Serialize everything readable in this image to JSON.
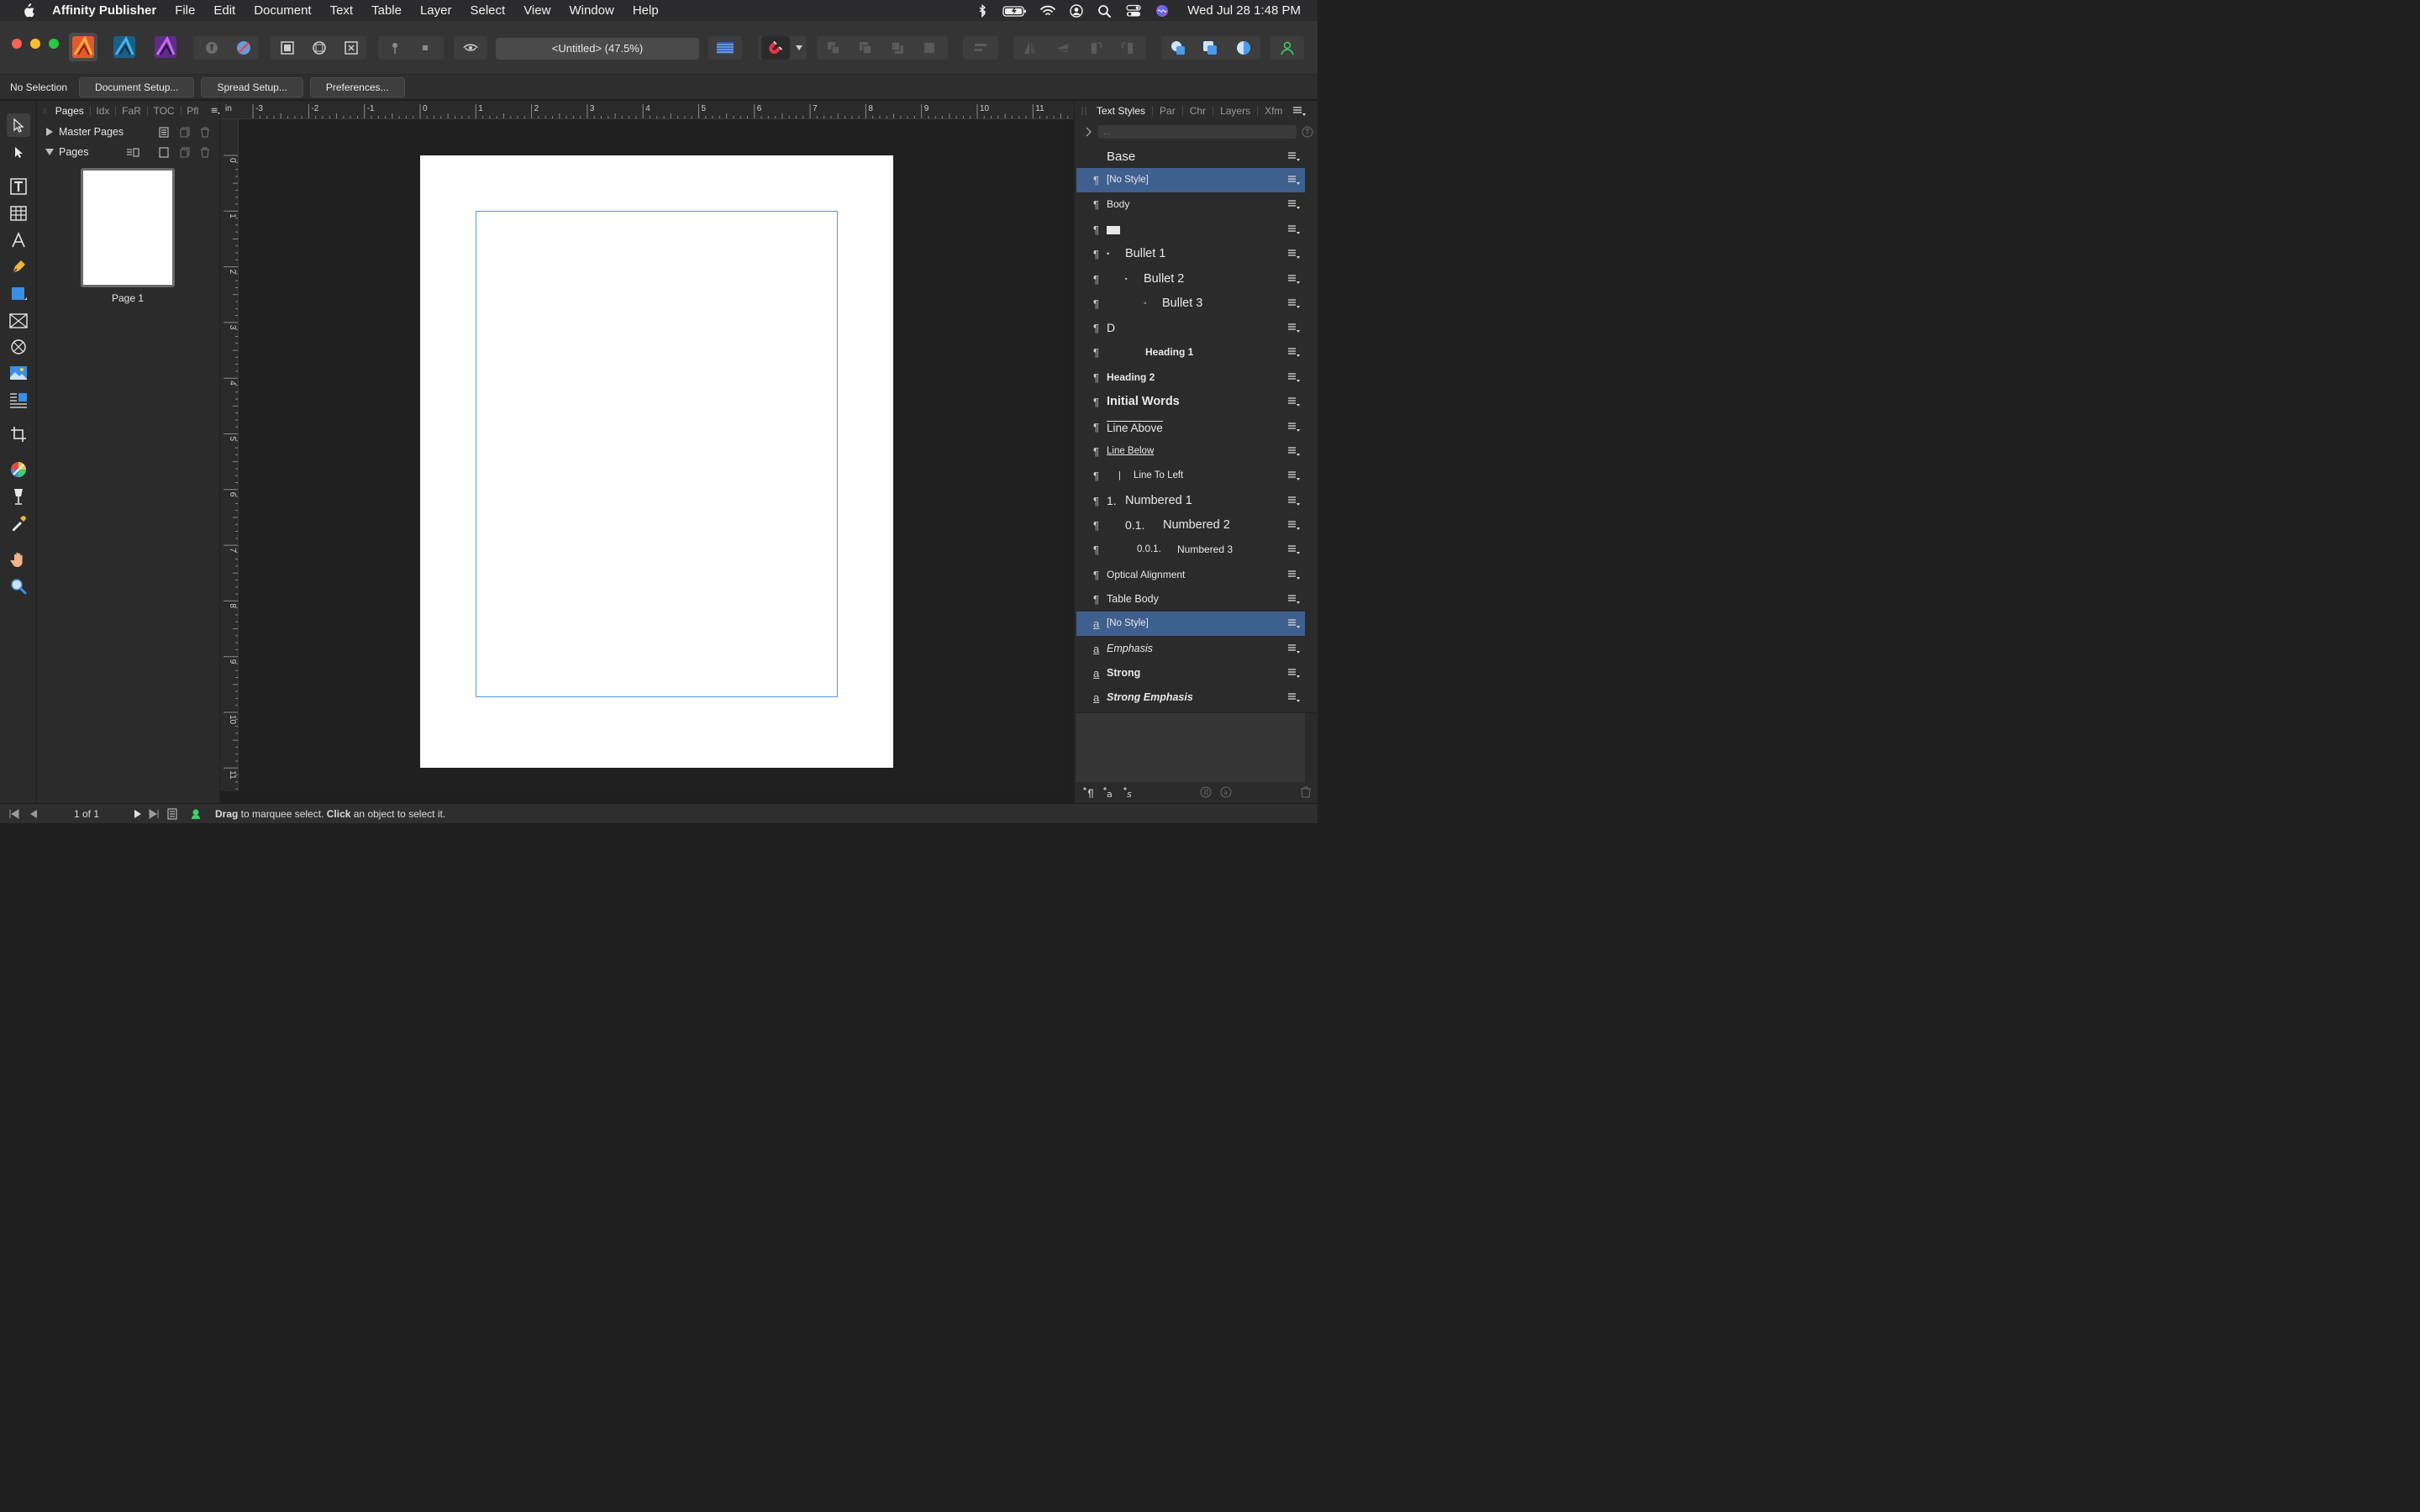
{
  "menubar": {
    "app_name": "Affinity Publisher",
    "items": [
      "File",
      "Edit",
      "Document",
      "Text",
      "Table",
      "Layer",
      "Select",
      "View",
      "Window",
      "Help"
    ],
    "clock": "Wed Jul 28  1:48 PM"
  },
  "toolbar": {
    "document_title": "<Untitled> (47.5%)"
  },
  "context": {
    "selection": "No Selection",
    "document_setup": "Document Setup...",
    "spread_setup": "Spread Setup...",
    "preferences": "Preferences..."
  },
  "pages_panel": {
    "tabs": [
      "Pages",
      "Idx",
      "FaR",
      "TOC",
      "Pfl"
    ],
    "master_pages": "Master Pages",
    "pages": "Pages",
    "page1_label": "Page 1"
  },
  "ruler": {
    "unit": "in",
    "top_ticks": [
      "-3",
      "-2",
      "-1",
      "0",
      "1",
      "2",
      "3",
      "4",
      "5",
      "6",
      "7",
      "8",
      "9",
      "10",
      "11"
    ],
    "left_ticks": [
      "0",
      "1",
      "2",
      "3",
      "4",
      "5",
      "6",
      "7",
      "8",
      "9",
      "10",
      "11"
    ]
  },
  "styles_panel": {
    "tabs": [
      "Text Styles",
      "Par",
      "Chr",
      "Layers",
      "Xfm"
    ],
    "search_placeholder": "...",
    "items": [
      {
        "name": "Base",
        "kind": "group"
      },
      {
        "name": "[No Style]",
        "kind": "para",
        "selected": true
      },
      {
        "name": "Body",
        "kind": "para"
      },
      {
        "name": "",
        "kind": "para",
        "swatch": true
      },
      {
        "name": "Bullet 1",
        "prefix": "•",
        "kind": "para"
      },
      {
        "name": "Bullet 2",
        "prefix": "▪",
        "kind": "para"
      },
      {
        "name": "Bullet 3",
        "prefix": "◦",
        "kind": "para"
      },
      {
        "name": "D",
        "kind": "para"
      },
      {
        "name": "Heading 1",
        "kind": "para"
      },
      {
        "name": "Heading 2",
        "kind": "para"
      },
      {
        "name": "Initial Words",
        "kind": "para"
      },
      {
        "name": "Line Above",
        "kind": "para"
      },
      {
        "name": "Line Below",
        "kind": "para"
      },
      {
        "name": "Line To Left",
        "prefix": "|",
        "kind": "para"
      },
      {
        "name": "Numbered 1",
        "prefix": "1.",
        "kind": "para"
      },
      {
        "name": "Numbered 2",
        "prefix": "0.1.",
        "kind": "para"
      },
      {
        "name": "Numbered 3",
        "prefix": "0.0.1.",
        "kind": "para"
      },
      {
        "name": "Optical Alignment",
        "kind": "para"
      },
      {
        "name": "Table Body",
        "kind": "para"
      },
      {
        "name": "[No Style]",
        "kind": "char",
        "selected": true
      },
      {
        "name": "Emphasis",
        "kind": "char"
      },
      {
        "name": "Strong",
        "kind": "char"
      },
      {
        "name": "Strong Emphasis",
        "kind": "char"
      }
    ]
  },
  "statusbar": {
    "page_count": "1 of 1",
    "hint_drag": "Drag",
    "hint_mid": " to marquee select. ",
    "hint_click": "Click",
    "hint_end": " an object to select it."
  },
  "colors": {
    "accent": "#4a9be8",
    "selection": "#3f5f8f",
    "panel": "#2b2b2b",
    "canvas": "#202020"
  }
}
